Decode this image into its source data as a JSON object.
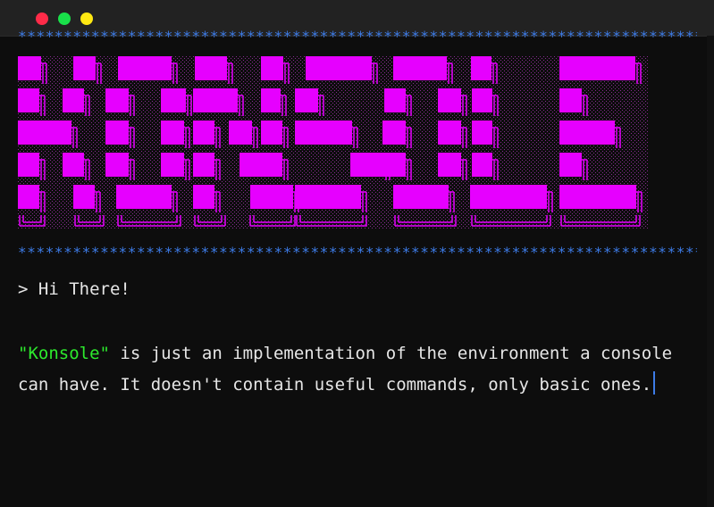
{
  "window": {
    "controls": [
      {
        "name": "close",
        "color": "#ff2b48"
      },
      {
        "name": "maximize",
        "color": "#19e04a"
      },
      {
        "name": "minimize",
        "color": "#ffe812"
      }
    ]
  },
  "colors": {
    "background": "#0d0d0d",
    "titlebar": "#222222",
    "stars": "#3d7be6",
    "banner": "#e600ff",
    "text": "#e6e6e6",
    "highlight": "#2dea2d",
    "caret": "#3d7be6"
  },
  "console": {
    "stars_line": "********************************************************************************************",
    "prompt": ">",
    "greeting": "Hi There!",
    "highlight_word": "\"Konsole\"",
    "message_rest": " is just an implementation of the environment a console can have. It doesn't contain useful commands, only basic ones."
  }
}
